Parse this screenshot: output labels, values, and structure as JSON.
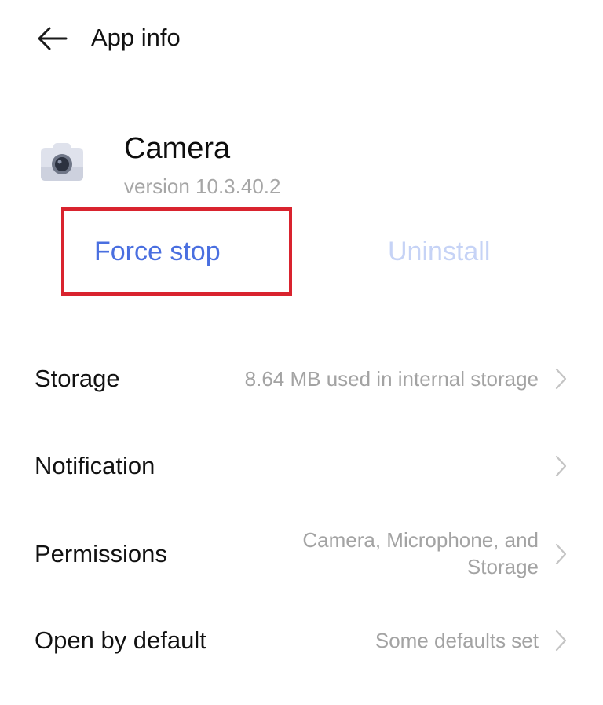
{
  "header": {
    "back_icon": "back-arrow-icon",
    "title": "App info"
  },
  "app": {
    "icon": "camera-app-icon",
    "name": "Camera",
    "version": "version 10.3.40.2"
  },
  "actions": {
    "force_stop_label": "Force stop",
    "uninstall_label": "Uninstall",
    "force_stop_color": "#4a6fe0",
    "uninstall_color": "#c6d3f6",
    "highlight_color": "#d9232e"
  },
  "settings": {
    "storage": {
      "label": "Storage",
      "value": "8.64 MB used in internal storage"
    },
    "notification": {
      "label": "Notification",
      "value": ""
    },
    "permissions": {
      "label": "Permissions",
      "value_line1": "Camera, Microphone, and",
      "value_line2": "Storage"
    },
    "open_by_default": {
      "label": "Open by default",
      "value": "Some defaults set"
    }
  }
}
